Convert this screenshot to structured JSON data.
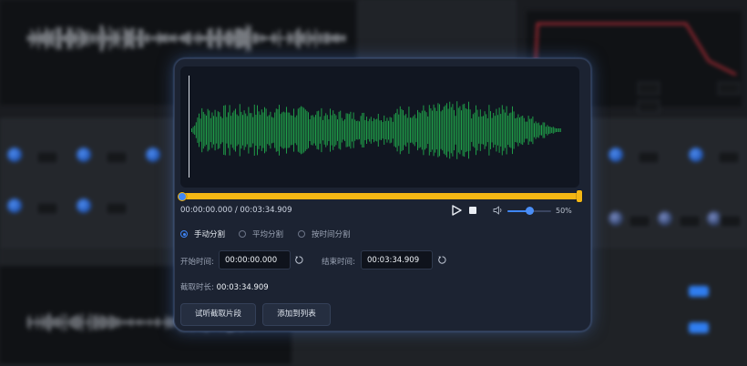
{
  "dialog": {
    "time": {
      "current": "00:00:00.000",
      "separator": "/",
      "total": "00:03:34.909"
    },
    "volume": {
      "percent": 50,
      "label": "50%"
    },
    "split_modes": [
      {
        "label": "手动分割",
        "selected": true
      },
      {
        "label": "平均分割",
        "selected": false
      },
      {
        "label": "按时间分割",
        "selected": false
      }
    ],
    "start": {
      "label": "开始时间:",
      "value": "00:00:00.000"
    },
    "end": {
      "label": "结束时间:",
      "value": "00:03:34.909"
    },
    "duration": {
      "label": "截取时长:",
      "value": "00:03:34.909"
    },
    "buttons": {
      "preview": "试听截取片段",
      "add": "添加到列表"
    },
    "colors": {
      "waveform": "#1f9b48",
      "progress": "#f4b714",
      "accent": "#3f86f7"
    }
  },
  "icons": [
    "play-icon",
    "stop-icon",
    "volume-icon",
    "reset-icon"
  ]
}
